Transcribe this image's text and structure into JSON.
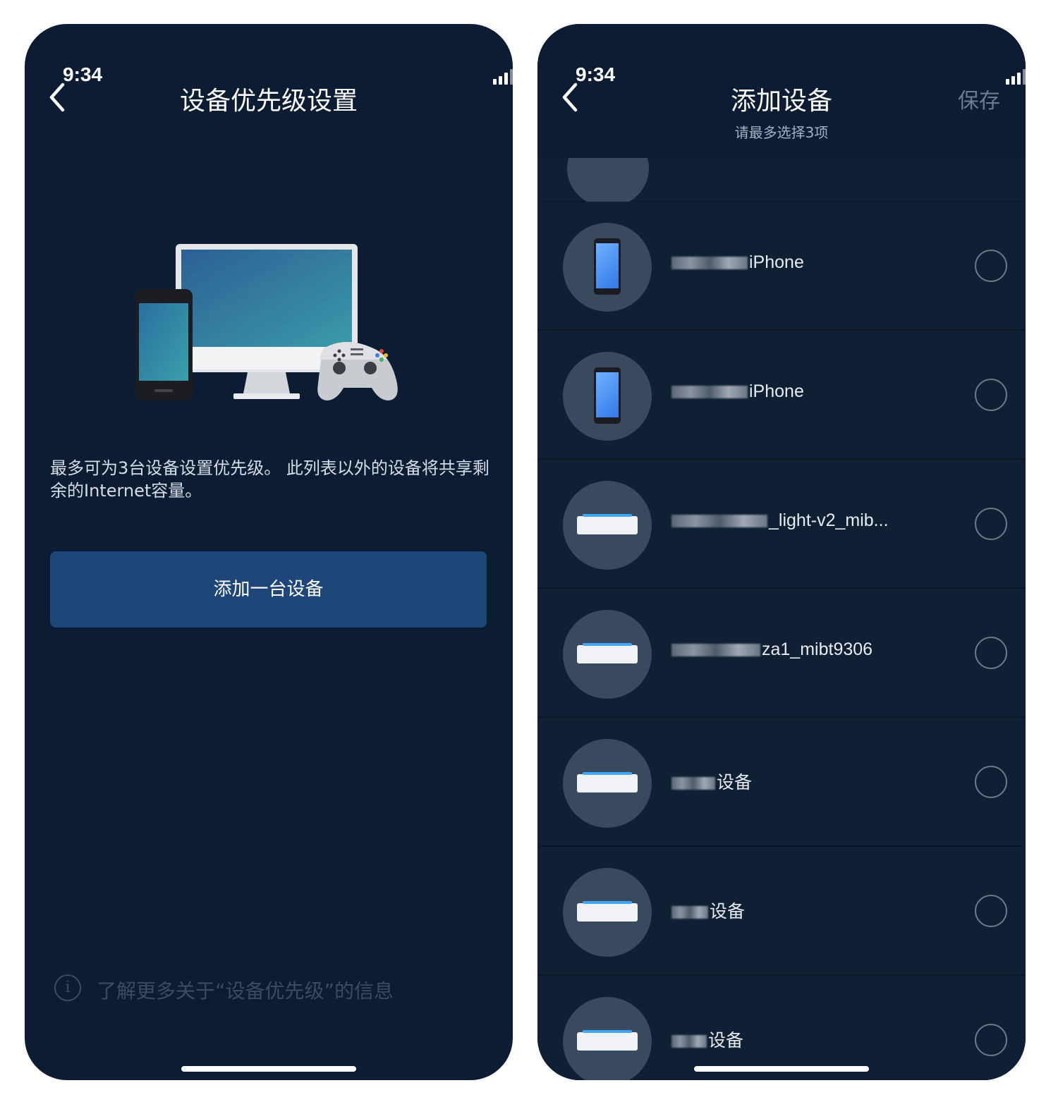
{
  "left_screen": {
    "status_time": "9:34",
    "title": "设备优先级设置",
    "description": "最多可为3台设备设置优先级。 此列表以外的设备将共享剩余的Internet容量。",
    "add_button_label": "添加一台设备",
    "info_text": "了解更多关于“设备优先级”的信息",
    "info_icon_char": "i"
  },
  "right_screen": {
    "status_time": "9:34",
    "title": "添加设备",
    "subtitle": "请最多选择3项",
    "save_label": "保存",
    "devices": [
      {
        "name": "iPhone",
        "icon": "phone-icon"
      },
      {
        "name": "iPhone",
        "icon": "phone-icon"
      },
      {
        "name": "_light-v2_mib...",
        "icon": "router-icon"
      },
      {
        "name": "za1_mibt9306",
        "icon": "router-icon"
      },
      {
        "name": "设备",
        "icon": "router-icon"
      },
      {
        "name": "设备",
        "icon": "router-icon"
      },
      {
        "name": "设备",
        "icon": "router-icon"
      }
    ]
  },
  "colors": {
    "background": "#0c1c33",
    "button": "#1e4678",
    "muted_text": "#3d4a60"
  }
}
